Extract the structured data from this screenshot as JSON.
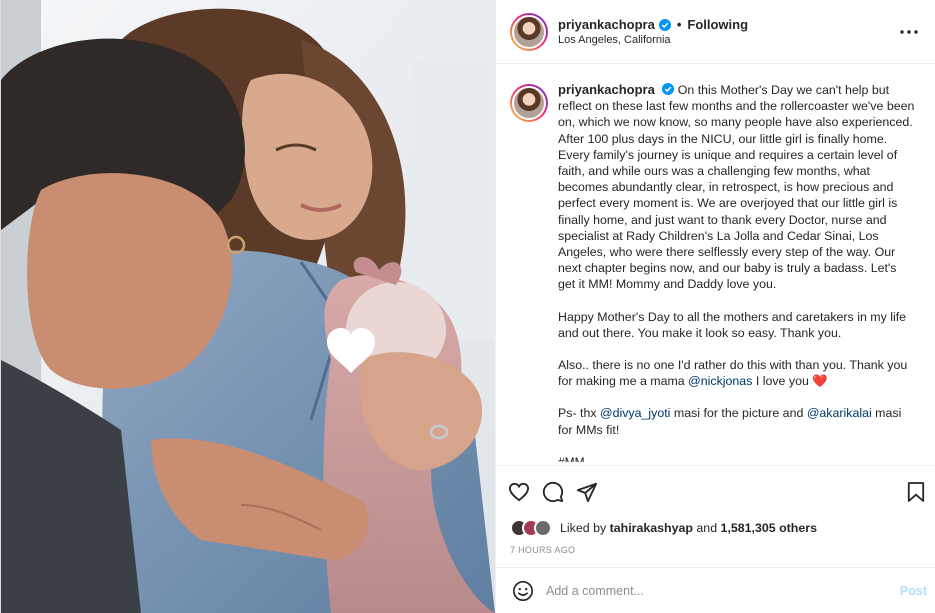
{
  "colors": {
    "accent": "#0095f6",
    "mention": "#00376b",
    "verified": "#0095f6",
    "post_disabled": "#b2dffc",
    "muted": "#8e8e8e"
  },
  "photo": {
    "icon": "white-heart-sticker-icon"
  },
  "header": {
    "username": "priyankachopra",
    "separator": "•",
    "follow_status": "Following",
    "location": "Los Angeles, California",
    "more_icon": "more-horizontal-icon"
  },
  "caption": {
    "username": "priyankachopra",
    "paragraph1": "On this Mother's Day we can't help but reflect on these last few months and the rollercoaster we've been on, which we now know, so many people have also experienced. After 100 plus days in the NICU, our little girl is finally home. Every family's journey is unique and requires a certain level of faith, and while ours was a challenging few months, what becomes abundantly clear, in retrospect, is how precious and perfect every moment is. We are overjoyed that our little girl is finally home, and just want to thank every Doctor, nurse and specialist at Rady Children's La Jolla and Cedar Sinai, Los Angeles, who were there selflessly every step of the way. Our next chapter begins now, and our baby is truly a badass. Let's get it MM! Mommy and Daddy love you.",
    "paragraph2": "Happy Mother's Day to all the mothers and caretakers in my life and out there. You make it look so easy. Thank you.",
    "paragraph3_a": "Also.. there is no one I'd rather do this with than you. Thank you for making me a mama ",
    "paragraph3_mention": "@nickjonas",
    "paragraph3_b": " I love you ",
    "paragraph3_emoji": "❤️",
    "paragraph4_a": "Ps- thx ",
    "paragraph4_mention1": "@divya_jyoti",
    "paragraph4_b": " masi for the picture and ",
    "paragraph4_mention2": "@akarikalai",
    "paragraph4_c": " masi for MMs fit!",
    "cutoff_text": "#MM"
  },
  "actions": {
    "like_icon": "heart-outline-icon",
    "comment_icon": "comment-bubble-icon",
    "share_icon": "paper-plane-icon",
    "save_icon": "bookmark-icon"
  },
  "likes": {
    "prefix": "Liked by ",
    "first_user": "tahirakashyap",
    "and": " and ",
    "count": "1,581,305 others"
  },
  "timestamp": "7 HOURS AGO",
  "comment": {
    "emoji_icon": "smiley-face-icon",
    "placeholder": "Add a comment...",
    "post_label": "Post"
  }
}
